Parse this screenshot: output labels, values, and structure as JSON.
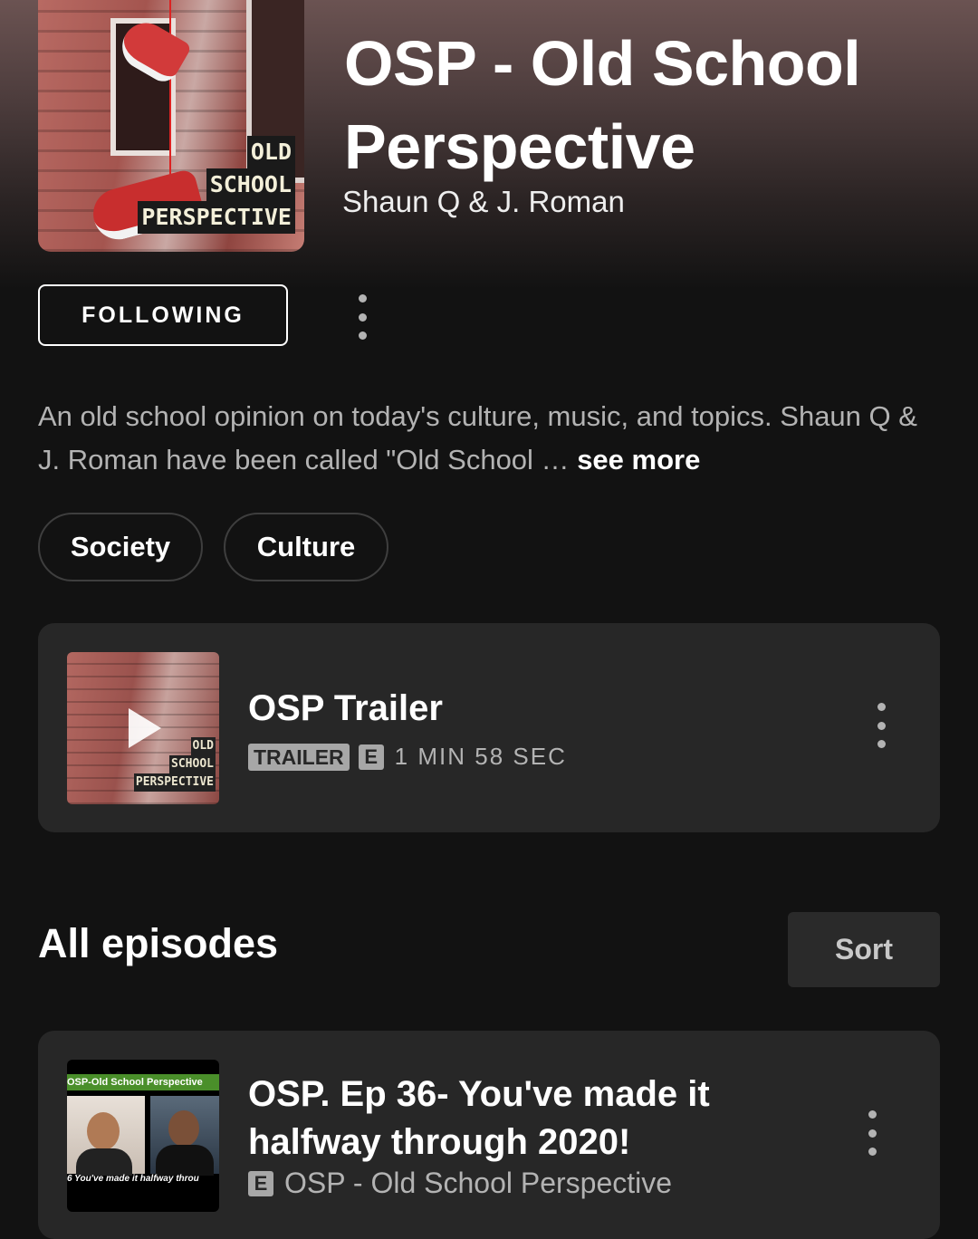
{
  "podcast": {
    "title": "OSP - Old School Perspective",
    "author": "Shaun Q & J. Roman",
    "cover_text": [
      "OLD",
      "SCHOOL",
      "PERSPECTIVE"
    ],
    "follow_label": "FOLLOWING",
    "description": "An old school opinion on today's culture, music, and topics. Shaun Q & J. Roman have been called \"Old School …",
    "see_more": "see more",
    "tags": [
      "Society",
      "Culture"
    ]
  },
  "trailer": {
    "title": "OSP Trailer",
    "badge": "TRAILER",
    "explicit": "E",
    "duration": "1 MIN 58 SEC",
    "thumb_text": [
      "OLD",
      "SCHOOL",
      "PERSPECTIVE"
    ]
  },
  "episodes_section": {
    "title": "All episodes",
    "sort_label": "Sort"
  },
  "episodes": [
    {
      "title": "OSP. Ep 36- You've made it halfway through 2020!",
      "explicit": "E",
      "show": "OSP - Old School Perspective",
      "thumb_banner": "OSP-Old School Perspective",
      "thumb_caption": "6 You've made it halfway throu"
    }
  ],
  "colors": {
    "background": "#121212",
    "card": "#272727",
    "secondary_text": "#b3b3b3"
  }
}
